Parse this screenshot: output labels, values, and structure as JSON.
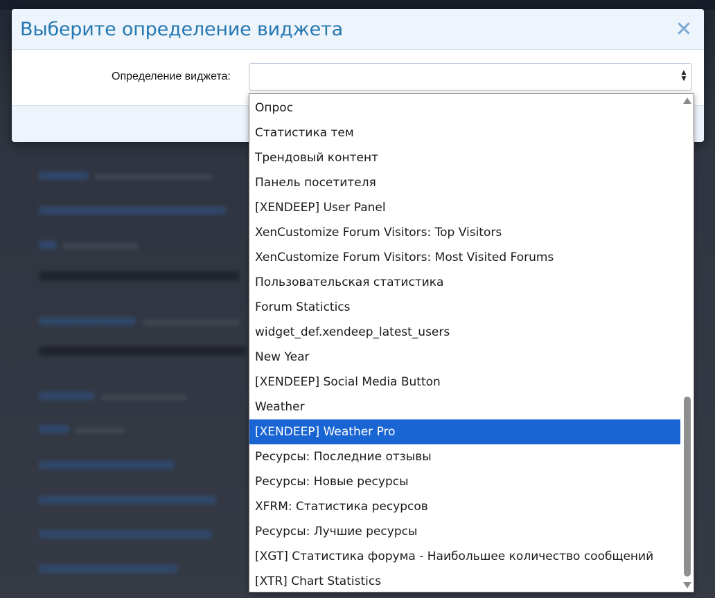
{
  "modal": {
    "title": "Выберите определение виджета",
    "close_icon": "close-icon",
    "field_label": "Определение виджета:",
    "select_value": "",
    "select_icon": "updown-arrows-icon"
  },
  "dropdown": {
    "selected_index": 13,
    "options": [
      "Опрос",
      "Статистика тем",
      "Трендовый контент",
      "Панель посетителя",
      "[XENDEEP] User Panel",
      "XenCustomize Forum Visitors: Top Visitors",
      "XenCustomize Forum Visitors: Most Visited Forums",
      "Пользовательская статистика",
      "Forum Statictics",
      "widget_def.xendeep_latest_users",
      "New Year",
      "[XENDEEP] Social Media Button",
      "Weather",
      "[XENDEEP] Weather Pro",
      "Ресурсы: Последние отзывы",
      "Ресурсы: Новые ресурсы",
      "XFRM: Статистика ресурсов",
      "Ресурсы: Лучшие ресурсы",
      "[XGT] Статистика форума - Наибольшее количество сообщений",
      "[XTR] Chart Statistics"
    ]
  },
  "colors": {
    "title": "#2577b1",
    "header_bg": "#edf4fb",
    "selected_option_bg": "#1a65d4",
    "close_icon": "#7ca9d3"
  }
}
